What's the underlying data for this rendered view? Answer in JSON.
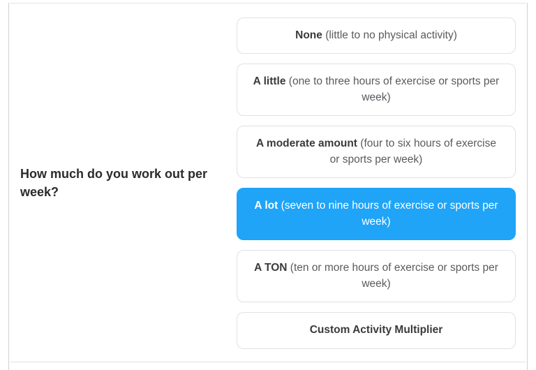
{
  "question": {
    "text": "How much do you work out per week?"
  },
  "options": [
    {
      "label": "None",
      "desc": "(little to no physical activity)",
      "selected": false
    },
    {
      "label": "A little",
      "desc": "(one to three hours of exercise or sports per week)",
      "selected": false
    },
    {
      "label": "A moderate amount",
      "desc": "(four to six hours of exercise or sports per week)",
      "selected": false
    },
    {
      "label": "A lot",
      "desc": "(seven to nine hours of exercise or sports per week)",
      "selected": true
    },
    {
      "label": "A TON",
      "desc": "(ten or more hours of exercise or sports per week)",
      "selected": false
    },
    {
      "label": "Custom Activity Multiplier",
      "desc": "",
      "selected": false
    }
  ]
}
